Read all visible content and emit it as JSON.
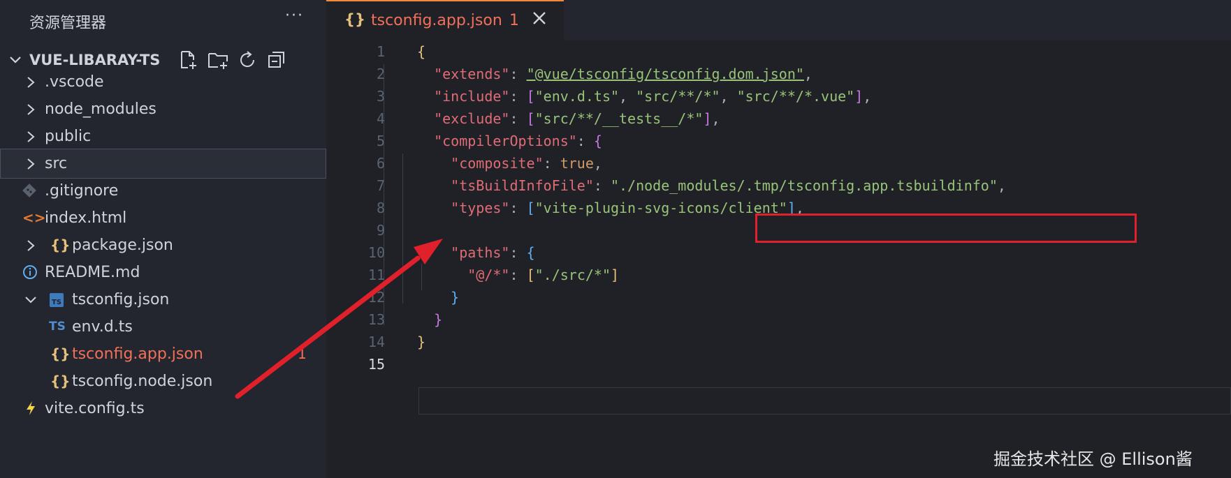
{
  "explorer": {
    "title": "资源管理器",
    "more_label": "···",
    "project_name": "VUE-LIBARAY-TS",
    "toolbar_icons": [
      "new-file-icon",
      "new-folder-icon",
      "refresh-icon",
      "collapse-all-icon"
    ],
    "tree": [
      {
        "label": ".vscode",
        "kind": "folder",
        "expanded": false
      },
      {
        "label": "node_modules",
        "kind": "folder",
        "expanded": false
      },
      {
        "label": "public",
        "kind": "folder",
        "expanded": false
      },
      {
        "label": "src",
        "kind": "folder",
        "expanded": false,
        "selected": true
      },
      {
        "label": ".gitignore",
        "kind": "git-file"
      },
      {
        "label": "index.html",
        "kind": "html-file"
      },
      {
        "label": "package.json",
        "kind": "json-file",
        "collapsible": true
      },
      {
        "label": "README.md",
        "kind": "info-file"
      },
      {
        "label": "tsconfig.json",
        "kind": "ts-file",
        "expanded": true
      },
      {
        "label": "env.d.ts",
        "kind": "ts-file"
      },
      {
        "label": "tsconfig.app.json",
        "kind": "json-file",
        "active": true,
        "badge": "1"
      },
      {
        "label": "tsconfig.node.json",
        "kind": "json-file"
      },
      {
        "label": "vite.config.ts",
        "kind": "vite-file"
      }
    ]
  },
  "tab": {
    "icon_glyph": "{}",
    "label": "tsconfig.app.json",
    "badge": "1",
    "close_icon": "close-icon"
  },
  "editor": {
    "line_numbers": [
      "1",
      "2",
      "3",
      "4",
      "5",
      "6",
      "7",
      "8",
      "9",
      "10",
      "11",
      "12",
      "13",
      "14",
      "15"
    ],
    "current_line": "15",
    "lines": {
      "l1": {
        "open": "{"
      },
      "l2": {
        "key": "\"extends\"",
        "colon": ": ",
        "val": "\"@vue/tsconfig/tsconfig.dom.json\"",
        "end": ","
      },
      "l3": {
        "key": "\"include\"",
        "colon": ": ",
        "open": "[",
        "v1": "\"env.d.ts\"",
        "c1": ", ",
        "v2": "\"src/**/*\"",
        "c2": ", ",
        "v3": "\"src/**/*.vue\"",
        "close": "]",
        "end": ","
      },
      "l4": {
        "key": "\"exclude\"",
        "colon": ": ",
        "open": "[",
        "v1": "\"src/**/__tests__/*\"",
        "close": "]",
        "end": ","
      },
      "l5": {
        "key": "\"compilerOptions\"",
        "colon": ": ",
        "open": "{"
      },
      "l6": {
        "key": "\"composite\"",
        "colon": ": ",
        "val": "true",
        "end": ","
      },
      "l7": {
        "key": "\"tsBuildInfoFile\"",
        "colon": ": ",
        "val": "\"./node_modules/.tmp/tsconfig.app.tsbuildinfo\"",
        "end": ","
      },
      "l8": {
        "key": "\"types\"",
        "colon": ": ",
        "open": "[",
        "v1": "\"vite-plugin-svg-icons/client\"",
        "close": "]",
        "end": ","
      },
      "l10": {
        "key": "\"paths\"",
        "colon": ": ",
        "open": "{"
      },
      "l11": {
        "key": "\"@/*\"",
        "colon": ": ",
        "open": "[",
        "v1": "\"./src/*\"",
        "close": "]"
      },
      "l12": {
        "close": "}"
      },
      "l13": {
        "close": "}"
      },
      "l14": {
        "close": "}"
      }
    }
  },
  "watermark": "掘金技术社区 @ Ellison酱",
  "colors": {
    "highlight_box": "#e0202a",
    "arrow": "#e0202a",
    "active_file": "#f2705a",
    "json_key": "#e06c75",
    "json_string": "#98c379"
  }
}
